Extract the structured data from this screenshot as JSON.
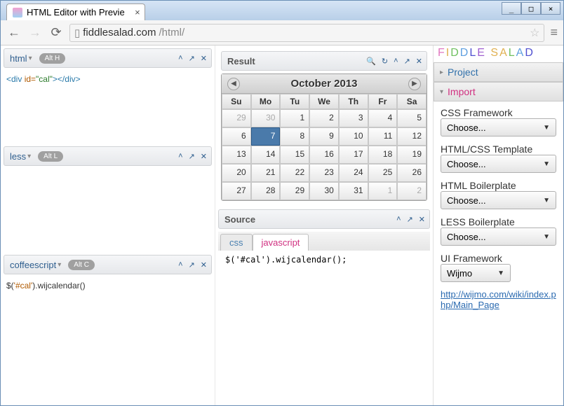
{
  "window": {
    "title": "HTML Editor with Previe",
    "url_host": "fiddlesalad.com",
    "url_path": "/html/"
  },
  "logo_text": "FIDDLE SALAD",
  "panels": {
    "html": {
      "label": "html",
      "shortcut": "Alt H"
    },
    "less": {
      "label": "less",
      "shortcut": "Alt L"
    },
    "coffee": {
      "label": "coffeescript",
      "shortcut": "Alt C"
    },
    "result": {
      "label": "Result"
    },
    "source": {
      "label": "Source"
    }
  },
  "code": {
    "html_tag_open": "<div",
    "html_attr": " id=",
    "html_str": "\"cal\"",
    "html_tag_mid": ">",
    "html_tag_close": "</div>",
    "coffee_pre": "$(",
    "coffee_sel": "'#cal'",
    "coffee_post": ").wijcalendar()"
  },
  "calendar": {
    "title": "October 2013",
    "dow": [
      "Su",
      "Mo",
      "Tu",
      "We",
      "Th",
      "Fr",
      "Sa"
    ],
    "grid": [
      [
        {
          "v": "29",
          "g": true
        },
        {
          "v": "30",
          "g": true
        },
        {
          "v": "1"
        },
        {
          "v": "2"
        },
        {
          "v": "3"
        },
        {
          "v": "4"
        },
        {
          "v": "5"
        }
      ],
      [
        {
          "v": "6"
        },
        {
          "v": "7",
          "sel": true
        },
        {
          "v": "8"
        },
        {
          "v": "9"
        },
        {
          "v": "10"
        },
        {
          "v": "11"
        },
        {
          "v": "12"
        }
      ],
      [
        {
          "v": "13"
        },
        {
          "v": "14"
        },
        {
          "v": "15"
        },
        {
          "v": "16"
        },
        {
          "v": "17"
        },
        {
          "v": "18"
        },
        {
          "v": "19"
        }
      ],
      [
        {
          "v": "20"
        },
        {
          "v": "21"
        },
        {
          "v": "22"
        },
        {
          "v": "23"
        },
        {
          "v": "24"
        },
        {
          "v": "25"
        },
        {
          "v": "26"
        }
      ],
      [
        {
          "v": "27"
        },
        {
          "v": "28"
        },
        {
          "v": "29"
        },
        {
          "v": "30"
        },
        {
          "v": "31"
        },
        {
          "v": "1",
          "g": true
        },
        {
          "v": "2",
          "g": true
        }
      ]
    ]
  },
  "source_tabs": {
    "css": "css",
    "js": "javascript"
  },
  "source_code": "$('#cal').wijcalendar();",
  "right": {
    "project": "Project",
    "import": "Import",
    "css_framework_label": "CSS Framework",
    "css_framework_value": "Choose...",
    "htmlcss_label": "HTML/CSS Template",
    "htmlcss_value": "Choose...",
    "htmlbp_label": "HTML Boilerplate",
    "htmlbp_value": "Choose...",
    "lessbp_label": "LESS Boilerplate",
    "lessbp_value": "Choose...",
    "uifw_label": "UI Framework",
    "uifw_value": "Wijmo",
    "link": "http://wijmo.com/wiki/index.php/Main_Page"
  }
}
